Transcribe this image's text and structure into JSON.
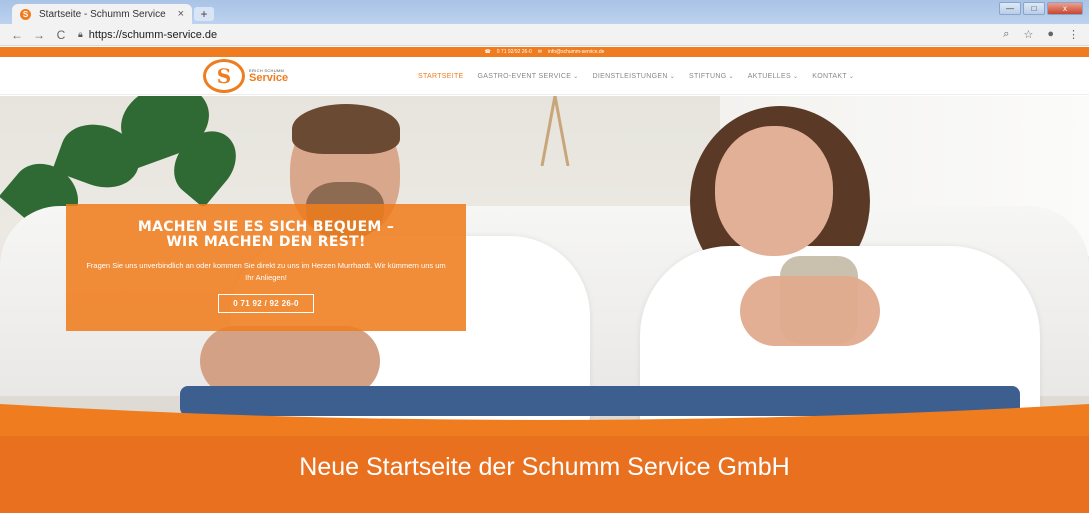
{
  "browser": {
    "tab_title": "Startseite - Schumm Service",
    "tab_close": "×",
    "new_tab": "+",
    "url": "https://schumm-service.de",
    "back": "←",
    "forward": "→",
    "reload": "C",
    "lock_icon": "lock-icon",
    "window_buttons": [
      "—",
      "□",
      "x"
    ]
  },
  "site": {
    "topbar": {
      "phone": "0 71 92/92 26-0",
      "email": "info@schumm-service.de"
    },
    "logo": {
      "small_text": "ERICH SCHUMM",
      "big_text": "Service"
    },
    "nav": [
      {
        "label": "STARTSEITE",
        "active": true,
        "dropdown": false
      },
      {
        "label": "GASTRO-EVENT SERVICE",
        "active": false,
        "dropdown": true
      },
      {
        "label": "DIENSTLEISTUNGEN",
        "active": false,
        "dropdown": true
      },
      {
        "label": "STIFTUNG",
        "active": false,
        "dropdown": true
      },
      {
        "label": "AKTUELLES",
        "active": false,
        "dropdown": true
      },
      {
        "label": "KONTAKT",
        "active": false,
        "dropdown": true
      }
    ],
    "hero": {
      "headline_line1": "MACHEN SIE ES SICH BEQUEM –",
      "headline_line2": "WIR MACHEN DEN REST!",
      "text": "Fragen Sie uns unverbindlich an oder kommen Sie direkt zu uns im Herzen Murrhardt. Wir kümmern uns um Ihr Anliegen!",
      "button": "0 71 92 / 92 26-0"
    }
  },
  "caption": "Neue Startseite der Schumm Service GmbH",
  "colors": {
    "brand_orange": "#ef7c1e",
    "caption_orange": "#e8701f"
  }
}
